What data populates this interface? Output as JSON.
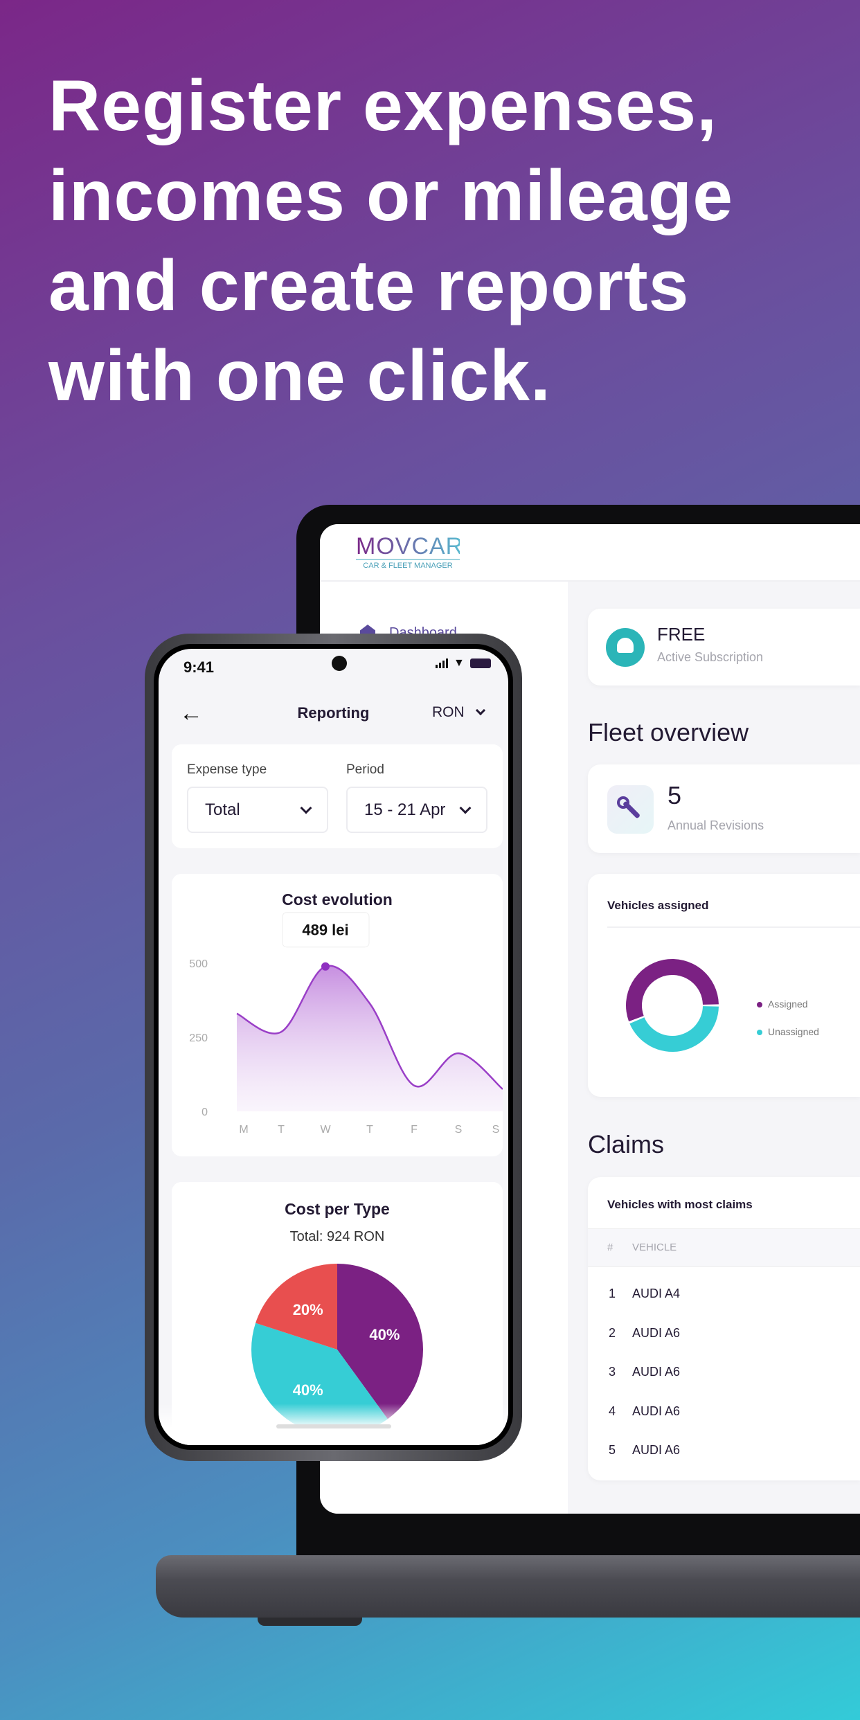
{
  "headline": [
    "Register expenses,",
    "incomes or mileage",
    "and create reports",
    "with one click."
  ],
  "colors": {
    "purple": "#7b2183",
    "cyan": "#36cdd5",
    "red": "#e84f4f",
    "dark": "#231a33"
  },
  "laptop": {
    "logo": {
      "main": "MOVCAR",
      "sub": "CAR & FLEET MANAGER"
    },
    "sidebar": {
      "items": [
        {
          "label": "Dashboard",
          "icon": "home-icon"
        }
      ]
    },
    "subscription": {
      "plan": "FREE",
      "label": "Active Subscription",
      "icon": "badge-cap-icon"
    },
    "fleet_overview": {
      "title": "Fleet overview",
      "revisions": {
        "value": "5",
        "label": "Annual Revisions",
        "icon": "wrench-icon"
      }
    },
    "vehicles_assigned": {
      "title": "Vehicles assigned",
      "legend": [
        "Assigned",
        "Unassigned"
      ],
      "fractions": {
        "assigned": 0.56,
        "unassigned": 0.44
      }
    },
    "claims": {
      "title": "Claims",
      "table_title": "Vehicles with most claims",
      "columns": [
        "#",
        "VEHICLE"
      ],
      "rows": [
        [
          "1",
          "AUDI A4"
        ],
        [
          "2",
          "AUDI A6"
        ],
        [
          "3",
          "AUDI A6"
        ],
        [
          "4",
          "AUDI A6"
        ],
        [
          "5",
          "AUDI A6"
        ]
      ]
    }
  },
  "phone": {
    "status": {
      "time": "9:41"
    },
    "header": {
      "title": "Reporting",
      "currency": "RON"
    },
    "filters": {
      "expense_label": "Expense type",
      "expense_value": "Total",
      "period_label": "Period",
      "period_value": "15 - 21 Apr"
    },
    "cost_evolution": {
      "title": "Cost evolution",
      "tooltip": "489 lei"
    },
    "cost_per_type": {
      "title": "Cost per Type",
      "total": "Total: 924 RON"
    }
  },
  "chart_data": [
    {
      "type": "area",
      "title": "Cost evolution",
      "categories": [
        "M",
        "T",
        "W",
        "T",
        "F",
        "S",
        "S"
      ],
      "values": [
        330,
        268,
        489,
        364,
        87,
        196,
        75
      ],
      "yticks": [
        "500",
        "250",
        "0"
      ],
      "ylim": [
        0,
        500
      ],
      "grid": false,
      "highlight": {
        "index": 2,
        "label": "489 lei"
      }
    },
    {
      "type": "pie",
      "title": "Cost per Type",
      "subtitle": "Total: 924 RON",
      "slices": [
        {
          "value": 40,
          "label": "40%",
          "color": "#7b2183"
        },
        {
          "value": 40,
          "label": "40%",
          "color": "#36cdd5"
        },
        {
          "value": 20,
          "label": "20%",
          "color": "#e84f4f"
        }
      ]
    }
  ]
}
